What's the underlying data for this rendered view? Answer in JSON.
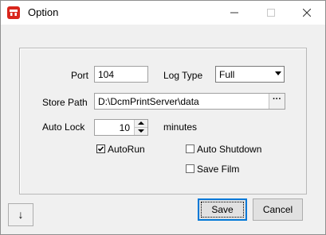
{
  "window": {
    "title": "Option"
  },
  "titlebar": {
    "minimize": "—",
    "maximize": "☐",
    "close": "✕"
  },
  "form": {
    "port_label": "Port",
    "port_value": "104",
    "log_type_label": "Log Type",
    "log_type_value": "Full",
    "store_path_label": "Store Path",
    "store_path_value": "D:\\DcmPrintServer\\data",
    "browse_label": "···",
    "auto_lock_label": "Auto Lock",
    "auto_lock_value": "10",
    "auto_lock_unit": "minutes",
    "autorun_label": "AutoRun",
    "autorun_checked": true,
    "auto_shutdown_label": "Auto Shutdown",
    "auto_shutdown_checked": false,
    "save_film_label": "Save Film",
    "save_film_checked": false
  },
  "footer": {
    "down_label": "↓",
    "save_label": "Save",
    "cancel_label": "Cancel"
  }
}
